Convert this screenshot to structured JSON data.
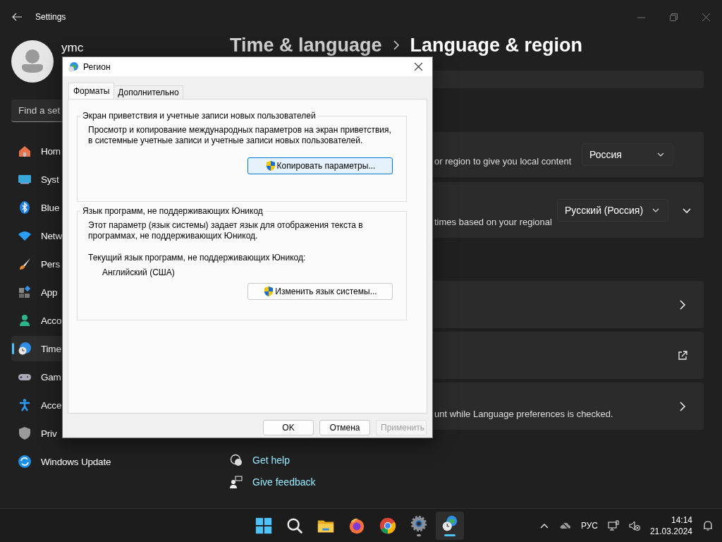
{
  "settings_window": {
    "title": "Settings",
    "user_name": "ymc",
    "search": {
      "placeholder": "Find a set"
    },
    "nav": [
      {
        "kind": "home",
        "label": "Hom",
        "selected": false
      },
      {
        "kind": "system",
        "label": "Syst",
        "selected": false
      },
      {
        "kind": "bluetooth",
        "label": "Blue",
        "selected": false
      },
      {
        "kind": "network",
        "label": "Netw",
        "selected": false
      },
      {
        "kind": "personalization",
        "label": "Pers",
        "selected": false
      },
      {
        "kind": "apps",
        "label": "App",
        "selected": false
      },
      {
        "kind": "accounts",
        "label": "Acco",
        "selected": false
      },
      {
        "kind": "time",
        "label": "Time",
        "selected": true
      },
      {
        "kind": "gaming",
        "label": "Gam",
        "selected": false
      },
      {
        "kind": "accessibility",
        "label": "Acce",
        "selected": false
      },
      {
        "kind": "privacy",
        "label": "Priv",
        "selected": false
      },
      {
        "kind": "update",
        "label": "Windows Update",
        "selected": false
      }
    ],
    "breadcrumb": [
      "Time & language",
      "Language & region"
    ],
    "cards": [
      {
        "kind": "strip"
      },
      {
        "kind": "dropdown",
        "text": "or region to give you local content",
        "value": "Россия"
      },
      {
        "kind": "dropdown_expand",
        "text": "times based on your regional",
        "value": "Русский (Россия)"
      },
      {
        "kind": "link"
      },
      {
        "kind": "external"
      },
      {
        "kind": "link",
        "text": "unt while Language preferences is checked."
      }
    ],
    "links": [
      {
        "kind": "help",
        "label": "Get help"
      },
      {
        "kind": "feedback",
        "label": "Give feedback"
      }
    ]
  },
  "dialog": {
    "title": "Регион",
    "tabs": [
      {
        "label": "Форматы",
        "selected": true
      },
      {
        "label": "Дополнительно",
        "selected": false
      }
    ],
    "groups": [
      {
        "legend": "Экран приветствия и учетные записи новых пользователей",
        "paragraphs": [
          "Просмотр и копирование международных параметров на экран приветствия, в системные учетные записи и учетные записи новых пользователей."
        ],
        "button": {
          "label": "Копировать параметры...",
          "default": true
        }
      },
      {
        "legend": "Язык программ, не поддерживающих Юникод",
        "paragraphs": [
          "Этот параметр (язык системы) задает язык для отображения текста в программах, не поддерживающих Юникод.",
          "Текущий язык программ, не поддерживающих Юникод:"
        ],
        "value": "Английский (США)",
        "button": {
          "label": "Изменить язык системы...",
          "default": false
        }
      }
    ],
    "buttons": [
      {
        "label": "OK",
        "disabled": false
      },
      {
        "label": "Отмена",
        "disabled": false
      },
      {
        "label": "Применить",
        "disabled": true
      }
    ]
  },
  "taskbar": {
    "apps": [
      {
        "kind": "start",
        "selected": false,
        "running": false
      },
      {
        "kind": "search",
        "selected": false,
        "running": false
      },
      {
        "kind": "explorer",
        "selected": false,
        "running": false
      },
      {
        "kind": "firefox",
        "selected": false,
        "running": false
      },
      {
        "kind": "chrome",
        "selected": false,
        "running": false
      },
      {
        "kind": "settings",
        "selected": false,
        "running": true
      },
      {
        "kind": "region",
        "selected": true,
        "running": true
      }
    ],
    "language": "РУС",
    "time": "14:14",
    "date": "21.03.2024"
  }
}
